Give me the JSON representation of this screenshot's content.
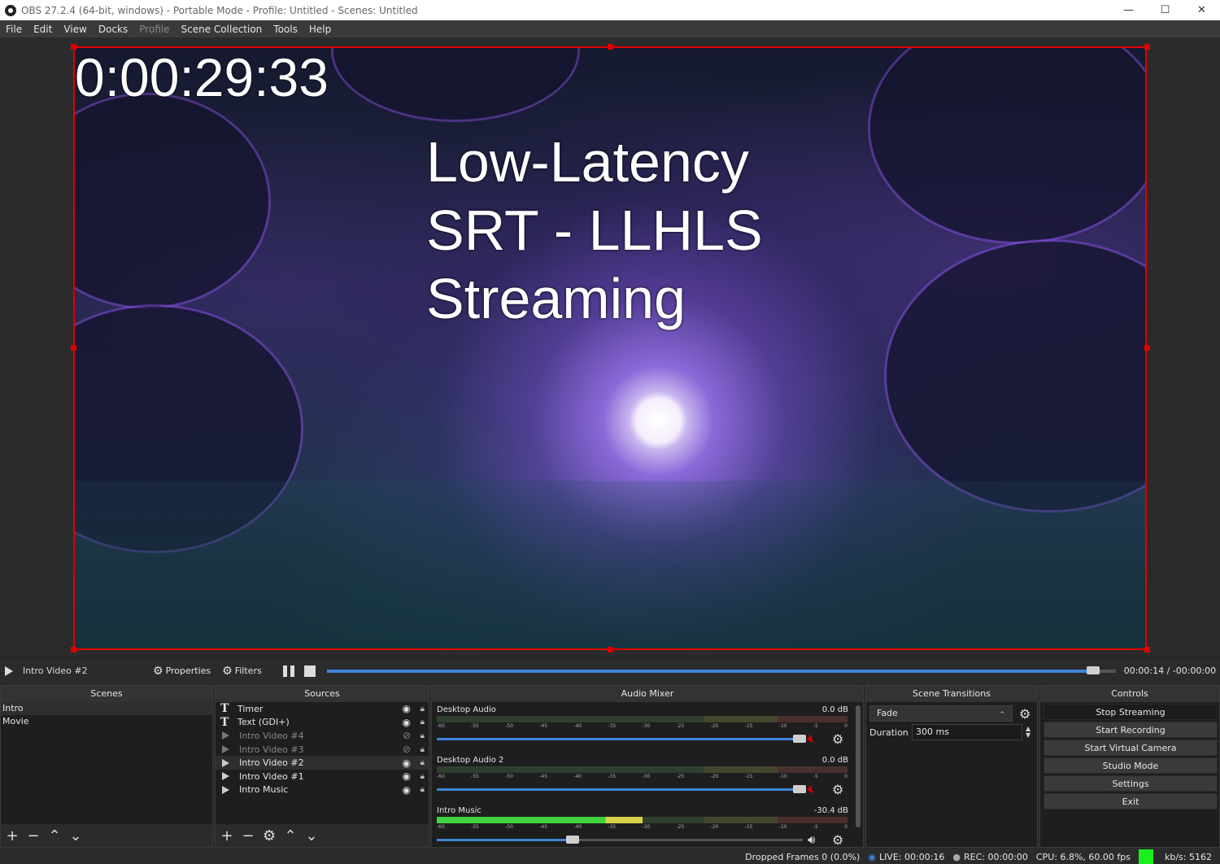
{
  "window": {
    "title": "OBS 27.2.4 (64-bit, windows) - Portable Mode - Profile: Untitled - Scenes: Untitled",
    "minimize": "—",
    "maximize": "☐",
    "close": "✕"
  },
  "menu": [
    "File",
    "Edit",
    "View",
    "Docks",
    "Profile",
    "Scene Collection",
    "Tools",
    "Help"
  ],
  "menu_disabled": [
    "Profile"
  ],
  "preview": {
    "timer": "0:00:29:33",
    "headline": [
      "Low-Latency",
      "SRT - LLHLS",
      "Streaming"
    ]
  },
  "media": {
    "source_name": "Intro Video #2",
    "properties_label": "Properties",
    "filters_label": "Filters",
    "time": "00:00:14 / -00:00:00",
    "progress": 0.98
  },
  "scenes": {
    "title": "Scenes",
    "items": [
      "Intro",
      "Movie"
    ],
    "selected": "Intro"
  },
  "sources": {
    "title": "Sources",
    "items": [
      {
        "name": "Timer",
        "type": "text",
        "visible": true
      },
      {
        "name": "Text (GDI+)",
        "type": "text",
        "visible": true
      },
      {
        "name": "Intro Video #4",
        "type": "media",
        "visible": false
      },
      {
        "name": "Intro Video #3",
        "type": "media",
        "visible": false
      },
      {
        "name": "Intro Video #2",
        "type": "media",
        "visible": true
      },
      {
        "name": "Intro Video #1",
        "type": "media",
        "visible": true
      },
      {
        "name": "Intro Music",
        "type": "media",
        "visible": true
      }
    ]
  },
  "mixer": {
    "title": "Audio Mixer",
    "ticks": [
      "-60",
      "-55",
      "-50",
      "-45",
      "-40",
      "-35",
      "-30",
      "-25",
      "-20",
      "-15",
      "-10",
      "-5",
      "0"
    ],
    "channels": [
      {
        "name": "Desktop Audio",
        "db": "0.0 dB",
        "level": 0.0,
        "volume": 1.0,
        "muted": true
      },
      {
        "name": "Desktop Audio 2",
        "db": "0.0 dB",
        "level": 0.0,
        "volume": 1.0,
        "muted": true
      },
      {
        "name": "Intro Music",
        "db": "-30.4 dB",
        "level": 0.5,
        "volume": 0.38,
        "muted": false
      }
    ]
  },
  "transitions": {
    "title": "Scene Transitions",
    "selected": "Fade",
    "duration_label": "Duration",
    "duration_value": "300 ms"
  },
  "controls": {
    "title": "Controls",
    "buttons": [
      "Stop Streaming",
      "Start Recording",
      "Start Virtual Camera",
      "Studio Mode",
      "Settings",
      "Exit"
    ]
  },
  "status": {
    "dropped": "Dropped Frames 0 (0.0%)",
    "live": "LIVE: 00:00:16",
    "rec": "REC: 00:00:00",
    "cpu": "CPU: 6.8%, 60.00 fps",
    "kbps": "kb/s: 5162",
    "health_color": "#1cf01c"
  },
  "colors": {
    "accent": "#3e86d9",
    "selection": "#e00000",
    "mute": "#e00000"
  }
}
